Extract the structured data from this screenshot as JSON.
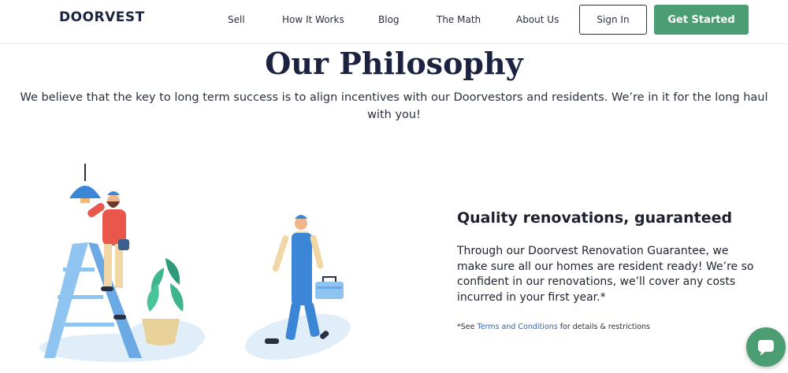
{
  "header": {
    "logo": "DOORVEST",
    "nav": [
      "Sell",
      "How It Works",
      "Blog",
      "The Math",
      "About Us"
    ],
    "sign_in": "Sign In",
    "get_started": "Get Started"
  },
  "hero": {
    "title": "Our Philosophy",
    "subtitle": "We believe that the key to long term success is to align incentives with our Doorvestors and residents. We’re in it for the long haul with you!"
  },
  "feature": {
    "title": "Quality renovations, guaranteed",
    "body": "Through our Doorvest Renovation Guarantee, we make sure all our homes are resident ready! We’re so confident in our renovations, we’ll cover any costs incurred in your first year.*",
    "note_prefix": "*See ",
    "note_link": "Terms and Conditions",
    "note_suffix": " for details & restrictions"
  },
  "colors": {
    "brand_green": "#4a9e72",
    "navy": "#1b2340",
    "link": "#2e63b6"
  },
  "icons": {
    "chat": "chat-bubble-icon"
  }
}
